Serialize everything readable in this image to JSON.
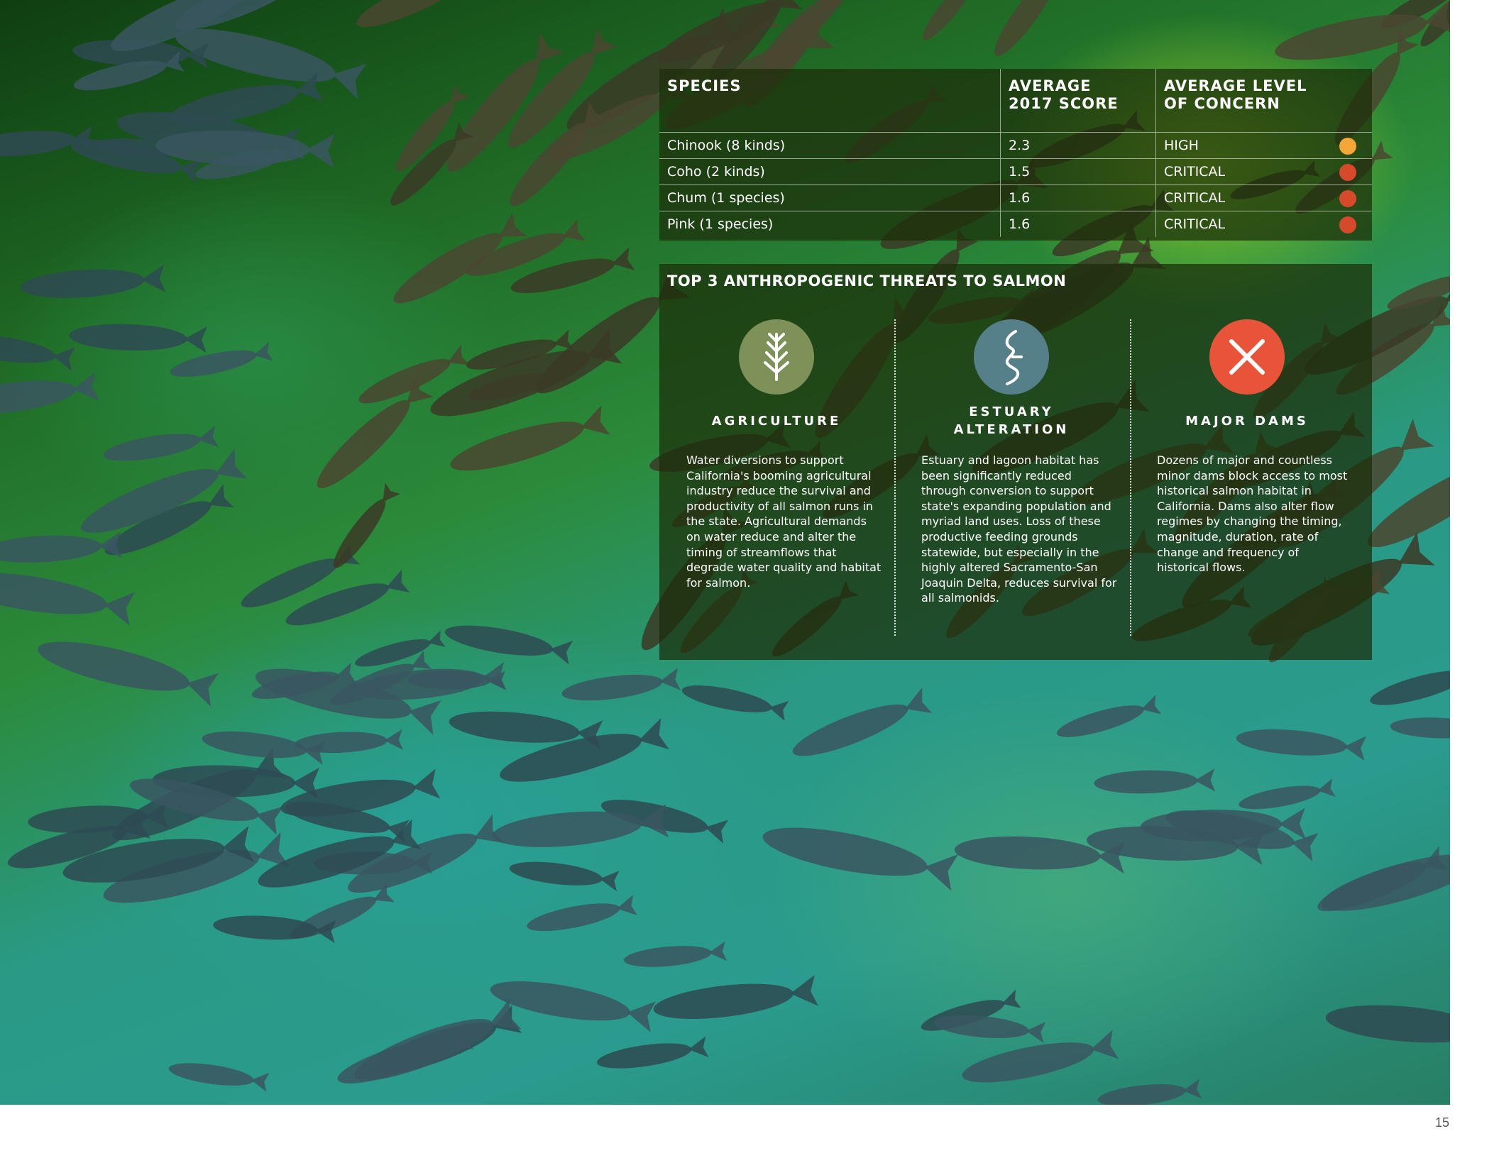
{
  "table": {
    "headers": [
      "SPECIES",
      "AVERAGE\n2017 SCORE",
      "AVERAGE LEVEL\nOF CONCERN"
    ],
    "rows": [
      {
        "species": "Chinook (8 kinds)",
        "score": "2.3",
        "concern": "HIGH",
        "color": "#f4a736"
      },
      {
        "species": "Coho (2 kinds)",
        "score": "1.5",
        "concern": "CRITICAL",
        "color": "#d64a2b"
      },
      {
        "species": "Chum (1 species)",
        "score": "1.6",
        "concern": "CRITICAL",
        "color": "#d64a2b"
      },
      {
        "species": "Pink (1 species)",
        "score": "1.6",
        "concern": "CRITICAL",
        "color": "#d64a2b"
      }
    ]
  },
  "threats": {
    "title": "TOP 3 ANTHROPOGENIC THREATS TO SALMON",
    "items": [
      {
        "label": "AGRICULTURE",
        "icon": "wheat-icon",
        "icon_color": "#7d9159",
        "description": "Water diversions to support California's booming agricultural industry reduce the survival and productivity of all salmon runs in the state. Agricultural demands on water reduce and alter the timing of streamflows that degrade water quality and habitat for salmon."
      },
      {
        "label": "ESTUARY ALTERATION",
        "icon": "river-icon",
        "icon_color": "#55808a",
        "description": "Estuary and lagoon habitat has been significantly reduced through conversion to support state's expanding population and myriad land uses. Loss of these productive feeding grounds statewide, but especially in the highly altered Sacramento-San Joaquin Delta, reduces survival for all salmonids."
      },
      {
        "label": "MAJOR DAMS",
        "icon": "x-icon",
        "icon_color": "#e8543a",
        "description": "Dozens of major and countless minor dams block access to most historical salmon habitat in California. Dams also alter flow regimes by changing the timing, magnitude, duration, rate of change and frequency of historical flows."
      }
    ]
  },
  "page_number": "15"
}
